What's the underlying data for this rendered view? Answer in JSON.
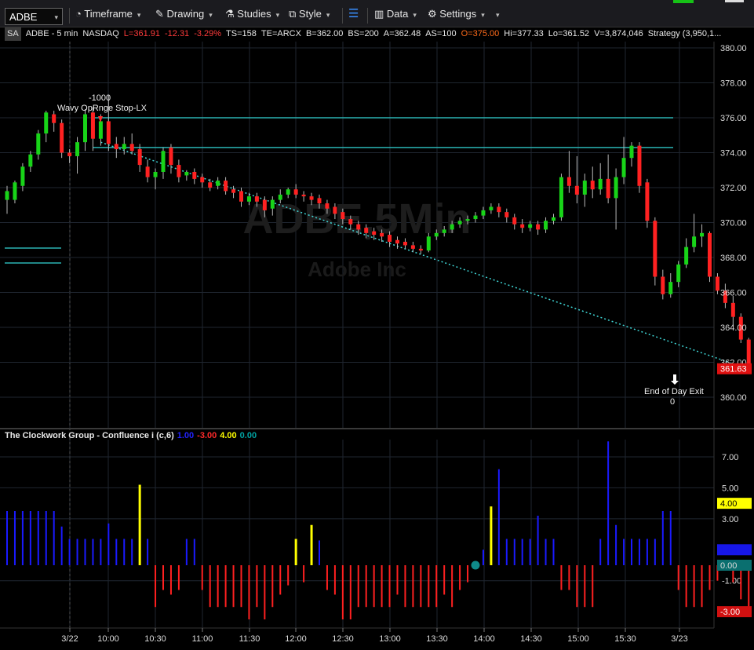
{
  "toolbar": {
    "symbol": "ADBE",
    "timeframe": "Timeframe",
    "drawing": "Drawing",
    "studies": "Studies",
    "style": "Style",
    "data": "Data",
    "settings": "Settings"
  },
  "info": {
    "badge": "SA",
    "name": "ADBE - 5 min",
    "exchange": "NASDAQ",
    "last": "L=361.91",
    "change": "-12.31",
    "pct": "-3.29%",
    "ts": "TS=158",
    "te": "TE=ARCX",
    "bid": "B=362.00",
    "bidsize": "BS=200",
    "ask": "A=362.48",
    "asksize": "AS=100",
    "open": "O=375.00",
    "high": "Hi=377.33",
    "low": "Lo=361.52",
    "volume": "V=3,874,046",
    "strategy": "Strategy (3,950,1..."
  },
  "watermark": {
    "symbol": "ADBE,5Min",
    "company": "Adobe Inc"
  },
  "annotations": {
    "entry_qty": "-1000",
    "entry_label": "Wavy OpRnge Stop-LX",
    "exit_label": "End of Day Exit",
    "exit_qty": "0"
  },
  "price_marker": "361.63",
  "indicator": {
    "title": "The Clockwork Group - Confluence i (c,6)",
    "v_blue": "1.00",
    "v_red": "-3.00",
    "v_yellow": "4.00",
    "v_teal": "0.00",
    "markers": [
      "4.00",
      "1.00",
      "0.00",
      "-3.00"
    ]
  },
  "colors": {
    "up": "#18d418",
    "down": "#ff2121",
    "grid": "#1f2630",
    "teal": "#2ab3b3",
    "blue": "#1a1aff",
    "red": "#ff2020",
    "yellow": "#ffff00"
  },
  "chart_data": [
    {
      "type": "candlestick",
      "ylim": [
        359,
        381
      ],
      "yticks": [
        "380.00",
        "378.00",
        "376.00",
        "374.00",
        "372.00",
        "370.00",
        "368.00",
        "366.00",
        "364.00",
        "362.00",
        "360.00"
      ],
      "xticks": [
        "3/22",
        "10:00",
        "10:30",
        "11:00",
        "11:30",
        "12:00",
        "12:30",
        "13:00",
        "13:30",
        "14:00",
        "14:30",
        "15:00",
        "15:30",
        "3/23"
      ],
      "hlines": [
        376.0,
        374.3
      ],
      "candles": [
        [
          371.3,
          371.8,
          370.5,
          372.1
        ],
        [
          371.3,
          372.3,
          371.1,
          372.4
        ],
        [
          372.1,
          373.2,
          371.8,
          373.4
        ],
        [
          373.2,
          373.9,
          372.9,
          374.1
        ],
        [
          373.9,
          375.1,
          373.6,
          375.3
        ],
        [
          375.1,
          376.3,
          374.6,
          376.4
        ],
        [
          376.2,
          375.7,
          375.2,
          376.4
        ],
        [
          375.7,
          374.0,
          373.7,
          375.9
        ],
        [
          374.0,
          373.8,
          373.4,
          374.2
        ],
        [
          373.8,
          374.6,
          372.8,
          374.9
        ],
        [
          374.6,
          376.2,
          374.1,
          376.5
        ],
        [
          376.3,
          374.8,
          374.1,
          376.6
        ],
        [
          374.8,
          375.8,
          374.4,
          376.2
        ],
        [
          375.8,
          374.5,
          374.1,
          377.3
        ],
        [
          374.5,
          374.2,
          373.7,
          374.9
        ],
        [
          374.2,
          374.5,
          373.9,
          374.9
        ],
        [
          374.5,
          374.1,
          373.9,
          375.1
        ],
        [
          374.2,
          373.3,
          372.9,
          374.5
        ],
        [
          373.2,
          372.6,
          372.3,
          373.6
        ],
        [
          372.6,
          372.9,
          371.9,
          373.1
        ],
        [
          372.9,
          374.1,
          372.5,
          374.3
        ],
        [
          374.3,
          373.3,
          372.8,
          374.5
        ],
        [
          373.3,
          372.6,
          372.3,
          373.6
        ],
        [
          372.7,
          372.9,
          372.4,
          373.0
        ],
        [
          372.9,
          372.5,
          372.2,
          373.1
        ],
        [
          372.6,
          372.3,
          372.0,
          372.8
        ],
        [
          372.3,
          372.0,
          371.8,
          372.5
        ],
        [
          372.1,
          372.4,
          371.9,
          372.6
        ],
        [
          372.4,
          371.8,
          371.6,
          372.6
        ],
        [
          371.9,
          371.7,
          371.4,
          372.1
        ],
        [
          371.8,
          371.2,
          370.9,
          372.0
        ],
        [
          371.2,
          371.5,
          371.0,
          371.7
        ],
        [
          371.5,
          371.2,
          370.9,
          371.7
        ],
        [
          371.3,
          370.7,
          370.3,
          371.5
        ],
        [
          370.8,
          371.3,
          370.4,
          371.5
        ],
        [
          371.3,
          371.6,
          371.1,
          371.9
        ],
        [
          371.6,
          371.9,
          371.4,
          372.0
        ],
        [
          371.9,
          371.6,
          371.4,
          372.2
        ],
        [
          371.6,
          371.5,
          371.2,
          371.8
        ],
        [
          371.5,
          371.3,
          371.0,
          371.7
        ],
        [
          371.4,
          371.1,
          370.8,
          371.6
        ],
        [
          371.1,
          370.8,
          370.5,
          371.3
        ],
        [
          370.9,
          370.5,
          370.2,
          371.1
        ],
        [
          370.6,
          370.2,
          369.9,
          370.8
        ],
        [
          370.2,
          369.9,
          369.6,
          370.4
        ],
        [
          369.9,
          369.6,
          369.3,
          370.1
        ],
        [
          369.7,
          369.4,
          369.1,
          369.9
        ],
        [
          369.5,
          369.3,
          369.0,
          369.7
        ],
        [
          369.4,
          369.2,
          368.9,
          369.6
        ],
        [
          369.3,
          368.9,
          368.6,
          369.5
        ],
        [
          369.0,
          368.8,
          368.5,
          369.2
        ],
        [
          368.9,
          368.7,
          368.5,
          369.1
        ],
        [
          368.7,
          368.5,
          368.3,
          368.9
        ],
        [
          368.5,
          368.4,
          368.2,
          368.7
        ],
        [
          368.4,
          369.2,
          368.3,
          369.4
        ],
        [
          369.2,
          369.4,
          369.0,
          369.6
        ],
        [
          369.4,
          369.6,
          369.2,
          369.8
        ],
        [
          369.6,
          369.9,
          369.4,
          370.1
        ],
        [
          369.9,
          370.1,
          369.7,
          370.3
        ],
        [
          370.1,
          370.2,
          369.9,
          370.4
        ],
        [
          370.2,
          370.4,
          370.0,
          370.6
        ],
        [
          370.4,
          370.7,
          370.2,
          370.9
        ],
        [
          370.7,
          370.9,
          370.5,
          371.1
        ],
        [
          370.9,
          370.6,
          370.3,
          371.1
        ],
        [
          370.6,
          370.3,
          370.0,
          370.8
        ],
        [
          370.3,
          369.9,
          369.6,
          370.5
        ],
        [
          369.9,
          369.7,
          369.4,
          370.2
        ],
        [
          369.7,
          369.9,
          369.5,
          370.1
        ],
        [
          369.9,
          369.6,
          369.3,
          370.1
        ],
        [
          369.6,
          370.1,
          369.4,
          370.3
        ],
        [
          370.1,
          370.3,
          369.9,
          370.5
        ],
        [
          370.3,
          372.6,
          370.1,
          372.8
        ],
        [
          372.6,
          372.1,
          371.7,
          374.1
        ],
        [
          372.1,
          371.6,
          371.1,
          373.8
        ],
        [
          371.6,
          372.4,
          370.9,
          372.8
        ],
        [
          372.4,
          371.9,
          371.4,
          373.2
        ],
        [
          371.9,
          372.5,
          371.6,
          373.4
        ],
        [
          372.5,
          371.4,
          371.1,
          373.9
        ],
        [
          371.4,
          372.6,
          369.6,
          373.1
        ],
        [
          372.6,
          373.7,
          372.2,
          374.9
        ],
        [
          373.7,
          374.4,
          373.2,
          374.6
        ],
        [
          374.4,
          372.1,
          371.7,
          374.6
        ],
        [
          372.3,
          370.1,
          369.7,
          372.5
        ],
        [
          370.1,
          366.9,
          366.4,
          370.3
        ],
        [
          366.9,
          365.9,
          365.6,
          367.3
        ],
        [
          365.9,
          366.6,
          365.7,
          367.1
        ],
        [
          366.6,
          367.6,
          366.3,
          367.8
        ],
        [
          367.6,
          368.6,
          367.4,
          369.1
        ],
        [
          368.6,
          369.2,
          368.3,
          370.5
        ],
        [
          369.2,
          369.4,
          368.6,
          369.9
        ],
        [
          369.4,
          366.9,
          366.6,
          369.5
        ],
        [
          366.9,
          366.1,
          365.9,
          367.1
        ],
        [
          366.1,
          365.4,
          365.1,
          366.5
        ],
        [
          365.4,
          364.6,
          364.1,
          365.8
        ],
        [
          364.6,
          363.3,
          363.1,
          364.8
        ],
        [
          363.3,
          361.6,
          361.5,
          363.4
        ]
      ]
    },
    {
      "type": "bar",
      "ylim": [
        -4.5,
        9.0
      ],
      "yticks": [
        "7.00",
        "5.00",
        "3.00",
        "-1.00"
      ],
      "values": [
        3.5,
        3.5,
        3.5,
        3.5,
        3.5,
        3.5,
        3.5,
        2.5,
        1.7,
        1.7,
        1.7,
        1.7,
        1.7,
        2.7,
        1.7,
        1.7,
        1.7,
        5.2,
        1.7,
        -2.7,
        -1.6,
        -1.9,
        -1.6,
        1.7,
        1.7,
        -1.6,
        -2.7,
        -2.7,
        -2.7,
        -2.7,
        -2.7,
        -3.5,
        -2.7,
        -3.5,
        -2.7,
        -1.9,
        -1.3,
        1.7,
        -1.1,
        2.6,
        1.6,
        -1.6,
        -1.9,
        -3.5,
        -3.5,
        -2.7,
        -2.7,
        -2.7,
        -2.7,
        -2.7,
        -1.9,
        -2.7,
        -2.7,
        -2.7,
        -2.7,
        -2.7,
        -1.9,
        -2.7,
        -1.6,
        -1.1,
        0.0,
        1.0,
        3.8,
        6.2,
        1.7,
        1.7,
        1.7,
        1.7,
        3.2,
        1.7,
        1.7,
        -1.6,
        -1.6,
        -2.7,
        -2.7,
        -2.7,
        1.7,
        8.0,
        2.6,
        1.7,
        1.7,
        1.7,
        1.7,
        1.7,
        3.5,
        3.5,
        -1.6,
        -2.7,
        -2.7,
        -2.7,
        -1.6,
        -1.0,
        0.0,
        -1.1,
        -2.2,
        -2.7,
        -2.7,
        -2.7,
        -2.7
      ],
      "yellow_bars": [
        17,
        37,
        39,
        62
      ],
      "dots": [
        60,
        92
      ]
    }
  ]
}
